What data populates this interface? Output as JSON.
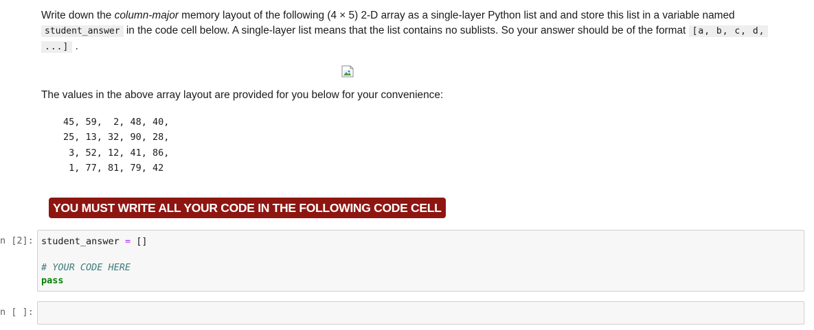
{
  "markdown": {
    "line1_pre": "Write down the ",
    "line1_em": "column-major",
    "line1_post": " memory layout of the following (4 × 5) 2-D array as a single-layer Python list and and store this list in a variable named",
    "var_name": "student_answer",
    "line2_mid": " in the code cell below. A single-layer list means that the list contains no sublists. So your answer should be of the format ",
    "format_a": "[a, b, c, d,",
    "format_b": "...]",
    "line3_post": " ."
  },
  "image": {
    "icon": "broken-image-icon"
  },
  "intro2": "The values in the above array layout are provided for you below for your convenience:",
  "values_rows": [
    "45, 59,  2, 48, 40,",
    "25, 13, 32, 90, 28,",
    " 3, 52, 12, 41, 86,",
    " 1, 77, 81, 79, 42"
  ],
  "warning": "YOU MUST WRITE ALL YOUR CODE IN THE FOLLOWING CODE CELL",
  "cells": [
    {
      "prompt": "n [2]:",
      "code": {
        "var": "student_answer",
        "eq": "=",
        "val": "[]",
        "comment": "# YOUR CODE HERE",
        "kw": "pass"
      }
    },
    {
      "prompt": "n [ ]:"
    }
  ],
  "colors": {
    "warning_bg": "#8e1611",
    "keyword": "#008000",
    "comment": "#3d7b7b",
    "operator": "#aa22ff"
  }
}
